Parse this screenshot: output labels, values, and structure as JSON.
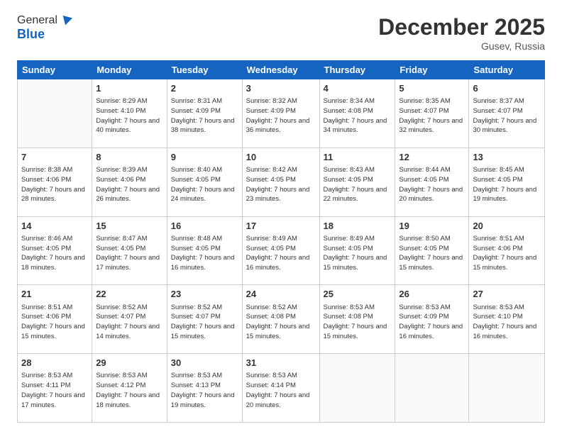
{
  "header": {
    "logo_general": "General",
    "logo_blue": "Blue",
    "month_title": "December 2025",
    "location": "Gusev, Russia"
  },
  "weekdays": [
    "Sunday",
    "Monday",
    "Tuesday",
    "Wednesday",
    "Thursday",
    "Friday",
    "Saturday"
  ],
  "weeks": [
    [
      {
        "day": "",
        "sunrise": "",
        "sunset": "",
        "daylight": ""
      },
      {
        "day": "1",
        "sunrise": "Sunrise: 8:29 AM",
        "sunset": "Sunset: 4:10 PM",
        "daylight": "Daylight: 7 hours and 40 minutes."
      },
      {
        "day": "2",
        "sunrise": "Sunrise: 8:31 AM",
        "sunset": "Sunset: 4:09 PM",
        "daylight": "Daylight: 7 hours and 38 minutes."
      },
      {
        "day": "3",
        "sunrise": "Sunrise: 8:32 AM",
        "sunset": "Sunset: 4:09 PM",
        "daylight": "Daylight: 7 hours and 36 minutes."
      },
      {
        "day": "4",
        "sunrise": "Sunrise: 8:34 AM",
        "sunset": "Sunset: 4:08 PM",
        "daylight": "Daylight: 7 hours and 34 minutes."
      },
      {
        "day": "5",
        "sunrise": "Sunrise: 8:35 AM",
        "sunset": "Sunset: 4:07 PM",
        "daylight": "Daylight: 7 hours and 32 minutes."
      },
      {
        "day": "6",
        "sunrise": "Sunrise: 8:37 AM",
        "sunset": "Sunset: 4:07 PM",
        "daylight": "Daylight: 7 hours and 30 minutes."
      }
    ],
    [
      {
        "day": "7",
        "sunrise": "Sunrise: 8:38 AM",
        "sunset": "Sunset: 4:06 PM",
        "daylight": "Daylight: 7 hours and 28 minutes."
      },
      {
        "day": "8",
        "sunrise": "Sunrise: 8:39 AM",
        "sunset": "Sunset: 4:06 PM",
        "daylight": "Daylight: 7 hours and 26 minutes."
      },
      {
        "day": "9",
        "sunrise": "Sunrise: 8:40 AM",
        "sunset": "Sunset: 4:05 PM",
        "daylight": "Daylight: 7 hours and 24 minutes."
      },
      {
        "day": "10",
        "sunrise": "Sunrise: 8:42 AM",
        "sunset": "Sunset: 4:05 PM",
        "daylight": "Daylight: 7 hours and 23 minutes."
      },
      {
        "day": "11",
        "sunrise": "Sunrise: 8:43 AM",
        "sunset": "Sunset: 4:05 PM",
        "daylight": "Daylight: 7 hours and 22 minutes."
      },
      {
        "day": "12",
        "sunrise": "Sunrise: 8:44 AM",
        "sunset": "Sunset: 4:05 PM",
        "daylight": "Daylight: 7 hours and 20 minutes."
      },
      {
        "day": "13",
        "sunrise": "Sunrise: 8:45 AM",
        "sunset": "Sunset: 4:05 PM",
        "daylight": "Daylight: 7 hours and 19 minutes."
      }
    ],
    [
      {
        "day": "14",
        "sunrise": "Sunrise: 8:46 AM",
        "sunset": "Sunset: 4:05 PM",
        "daylight": "Daylight: 7 hours and 18 minutes."
      },
      {
        "day": "15",
        "sunrise": "Sunrise: 8:47 AM",
        "sunset": "Sunset: 4:05 PM",
        "daylight": "Daylight: 7 hours and 17 minutes."
      },
      {
        "day": "16",
        "sunrise": "Sunrise: 8:48 AM",
        "sunset": "Sunset: 4:05 PM",
        "daylight": "Daylight: 7 hours and 16 minutes."
      },
      {
        "day": "17",
        "sunrise": "Sunrise: 8:49 AM",
        "sunset": "Sunset: 4:05 PM",
        "daylight": "Daylight: 7 hours and 16 minutes."
      },
      {
        "day": "18",
        "sunrise": "Sunrise: 8:49 AM",
        "sunset": "Sunset: 4:05 PM",
        "daylight": "Daylight: 7 hours and 15 minutes."
      },
      {
        "day": "19",
        "sunrise": "Sunrise: 8:50 AM",
        "sunset": "Sunset: 4:05 PM",
        "daylight": "Daylight: 7 hours and 15 minutes."
      },
      {
        "day": "20",
        "sunrise": "Sunrise: 8:51 AM",
        "sunset": "Sunset: 4:06 PM",
        "daylight": "Daylight: 7 hours and 15 minutes."
      }
    ],
    [
      {
        "day": "21",
        "sunrise": "Sunrise: 8:51 AM",
        "sunset": "Sunset: 4:06 PM",
        "daylight": "Daylight: 7 hours and 15 minutes."
      },
      {
        "day": "22",
        "sunrise": "Sunrise: 8:52 AM",
        "sunset": "Sunset: 4:07 PM",
        "daylight": "Daylight: 7 hours and 14 minutes."
      },
      {
        "day": "23",
        "sunrise": "Sunrise: 8:52 AM",
        "sunset": "Sunset: 4:07 PM",
        "daylight": "Daylight: 7 hours and 15 minutes."
      },
      {
        "day": "24",
        "sunrise": "Sunrise: 8:52 AM",
        "sunset": "Sunset: 4:08 PM",
        "daylight": "Daylight: 7 hours and 15 minutes."
      },
      {
        "day": "25",
        "sunrise": "Sunrise: 8:53 AM",
        "sunset": "Sunset: 4:08 PM",
        "daylight": "Daylight: 7 hours and 15 minutes."
      },
      {
        "day": "26",
        "sunrise": "Sunrise: 8:53 AM",
        "sunset": "Sunset: 4:09 PM",
        "daylight": "Daylight: 7 hours and 16 minutes."
      },
      {
        "day": "27",
        "sunrise": "Sunrise: 8:53 AM",
        "sunset": "Sunset: 4:10 PM",
        "daylight": "Daylight: 7 hours and 16 minutes."
      }
    ],
    [
      {
        "day": "28",
        "sunrise": "Sunrise: 8:53 AM",
        "sunset": "Sunset: 4:11 PM",
        "daylight": "Daylight: 7 hours and 17 minutes."
      },
      {
        "day": "29",
        "sunrise": "Sunrise: 8:53 AM",
        "sunset": "Sunset: 4:12 PM",
        "daylight": "Daylight: 7 hours and 18 minutes."
      },
      {
        "day": "30",
        "sunrise": "Sunrise: 8:53 AM",
        "sunset": "Sunset: 4:13 PM",
        "daylight": "Daylight: 7 hours and 19 minutes."
      },
      {
        "day": "31",
        "sunrise": "Sunrise: 8:53 AM",
        "sunset": "Sunset: 4:14 PM",
        "daylight": "Daylight: 7 hours and 20 minutes."
      },
      {
        "day": "",
        "sunrise": "",
        "sunset": "",
        "daylight": ""
      },
      {
        "day": "",
        "sunrise": "",
        "sunset": "",
        "daylight": ""
      },
      {
        "day": "",
        "sunrise": "",
        "sunset": "",
        "daylight": ""
      }
    ]
  ]
}
